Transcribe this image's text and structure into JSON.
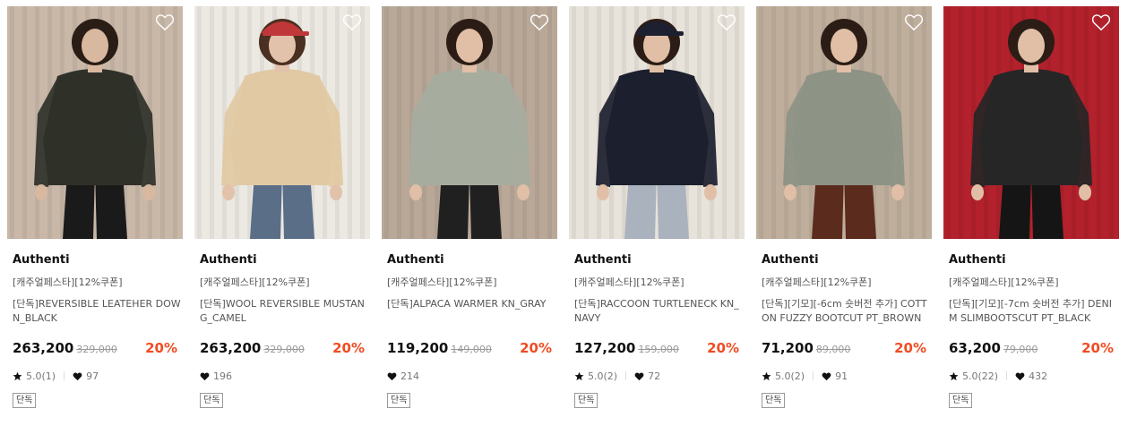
{
  "products": [
    {
      "brand": "Authenti",
      "tagline": "[캐주얼페스타][12%쿠폰]",
      "name": "[단독]REVERSIBLE LEATEHER DOWN_BLACK",
      "price": "263,200",
      "original_price": "329,000",
      "discount": "20%",
      "rating": "5.0(1)",
      "likes": "97",
      "badge": "단독",
      "image": {
        "bg": "#c9b8a8",
        "garment": "#2f3129",
        "bottom": "#1a1a1a",
        "skin": "#d9b8a0",
        "hair": "#2a1d16",
        "hat": ""
      }
    },
    {
      "brand": "Authenti",
      "tagline": "[캐주얼페스타][12%쿠폰]",
      "name": "[단독]WOOL REVERSIBLE MUSTANG_CAMEL",
      "price": "263,200",
      "original_price": "329,000",
      "discount": "20%",
      "rating": "",
      "likes": "196",
      "badge": "단독",
      "image": {
        "bg": "#ece9e3",
        "garment": "#e1c9a3",
        "bottom": "#5a6e88",
        "skin": "#e2c2aa",
        "hair": "#4b2f20",
        "hat": "#c0373a"
      }
    },
    {
      "brand": "Authenti",
      "tagline": "[캐주얼페스타][12%쿠폰]",
      "name": "[단독]ALPACA WARMER KN_GRAY",
      "price": "119,200",
      "original_price": "149,000",
      "discount": "20%",
      "rating": "",
      "likes": "214",
      "badge": "단독",
      "image": {
        "bg": "#b9a898",
        "garment": "#a6ad9f",
        "bottom": "#202020",
        "skin": "#e0bfa6",
        "hair": "#2b1d16",
        "hat": ""
      }
    },
    {
      "brand": "Authenti",
      "tagline": "[캐주얼페스타][12%쿠폰]",
      "name": "[단독]RACCOON TURTLENECK KN_NAVY",
      "price": "127,200",
      "original_price": "159,000",
      "discount": "20%",
      "rating": "5.0(2)",
      "likes": "72",
      "badge": "단독",
      "image": {
        "bg": "#e7e2da",
        "garment": "#1c1f2e",
        "bottom": "#aab3bd",
        "skin": "#e0bfa6",
        "hair": "#2b1d16",
        "hat": "#1d2030"
      }
    },
    {
      "brand": "Authenti",
      "tagline": "[캐주얼페스타][12%쿠폰]",
      "name": "[단독][기모][-6cm 숏버전 추가] COTTON FUZZY BOOTCUT PT_BROWN",
      "price": "71,200",
      "original_price": "89,000",
      "discount": "20%",
      "rating": "5.0(2)",
      "likes": "91",
      "badge": "단독",
      "image": {
        "bg": "#bfae9c",
        "garment": "#8d9385",
        "bottom": "#5b2b1d",
        "skin": "#e0bfa6",
        "hair": "#2b1d16",
        "hat": ""
      }
    },
    {
      "brand": "Authenti",
      "tagline": "[캐주얼페스타][12%쿠폰]",
      "name": "[단독][기모][-7cm 숏버전 추가] DENIM SLIMBOOTSCUT PT_BLACK",
      "price": "63,200",
      "original_price": "79,000",
      "discount": "20%",
      "rating": "5.0(22)",
      "likes": "432",
      "badge": "단독",
      "image": {
        "bg": "#b3212c",
        "garment": "#262626",
        "bottom": "#151515",
        "skin": "#e0bfa6",
        "hair": "#2b1d16",
        "hat": ""
      }
    }
  ],
  "colors": {
    "discount": "#f04c23",
    "price": "#111111",
    "muted": "#777777"
  },
  "icons": {
    "wishlist": "heart-outline-icon",
    "rating": "star-icon",
    "likes": "heart-filled-icon"
  }
}
